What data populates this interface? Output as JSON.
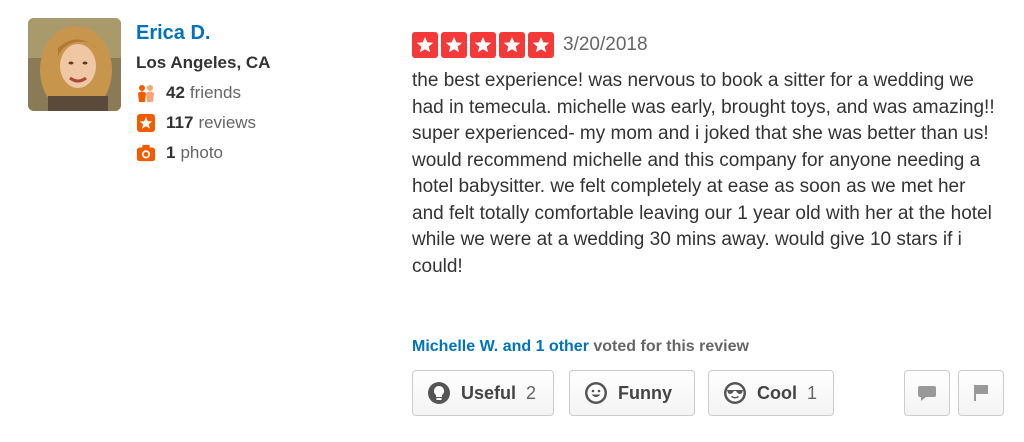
{
  "user": {
    "name": "Erica D.",
    "location": "Los Angeles, CA",
    "friends_count": "42",
    "friends_label": "friends",
    "reviews_count": "117",
    "reviews_label": "reviews",
    "photos_count": "1",
    "photos_label": "photo"
  },
  "review": {
    "rating": 5,
    "date": "3/20/2018",
    "text": "the best experience! was nervous to book a sitter for a wedding we had in temecula. michelle was early, brought toys, and was amazing!! super experienced- my mom and i joked that she was better than us! would recommend michelle and this company for anyone needing a hotel babysitter. we felt completely at ease as soon as we met her and felt totally comfortable leaving our 1 year old with her at the hotel while we were at a wedding 30 mins away. would give 10 stars if i could!"
  },
  "votes": {
    "voters_link": "Michelle W. and 1 other",
    "suffix": " voted for this review"
  },
  "buttons": {
    "useful_label": "Useful",
    "useful_count": "2",
    "funny_label": "Funny",
    "funny_count": "",
    "cool_label": "Cool",
    "cool_count": "1"
  },
  "icons": {
    "friends": "friends-icon",
    "reviews": "star-review-icon",
    "photos": "camera-icon",
    "useful": "lightbulb-icon",
    "funny": "smiley-icon",
    "cool": "sunglasses-icon",
    "comment": "speech-bubble-icon",
    "flag": "flag-icon"
  },
  "colors": {
    "star_red": "#f43939",
    "link_blue": "#0073bb",
    "orange": "#f15c00"
  }
}
